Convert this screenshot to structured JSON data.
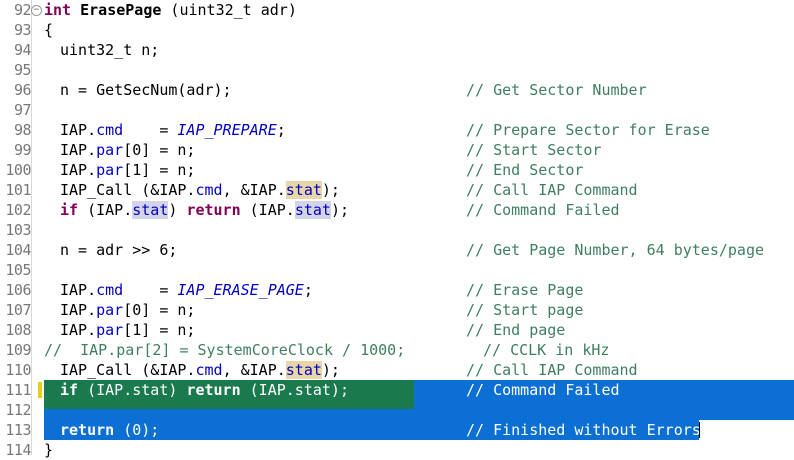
{
  "editor": {
    "function_name": "ErasePage",
    "lines": [
      {
        "n": "92",
        "fold": true,
        "code_kw": "int",
        "code_name": "ErasePage",
        "code_rest": " (uint32_t adr)",
        "comment": ""
      },
      {
        "n": "93",
        "code": "{",
        "comment": ""
      },
      {
        "n": "94",
        "code": "uint32_t n;",
        "comment": ""
      },
      {
        "n": "95",
        "code": "",
        "comment": ""
      },
      {
        "n": "96",
        "code": "n = GetSecNum(adr);",
        "comment": "// Get Sector Number"
      },
      {
        "n": "97",
        "code": "",
        "comment": ""
      },
      {
        "n": "98",
        "code_prefix": "IAP.",
        "code_field": "cmd",
        "code_mid": "    = ",
        "code_macro": "IAP_PREPARE",
        "code_tail": ";",
        "comment": "// Prepare Sector for Erase"
      },
      {
        "n": "99",
        "code_prefix": "IAP.",
        "code_field": "par",
        "code_tail": "[0] = n;",
        "comment": "// Start Sector"
      },
      {
        "n": "100",
        "code_prefix": "IAP.",
        "code_field": "par",
        "code_tail": "[1] = n;",
        "comment": "// End Sector"
      },
      {
        "n": "101",
        "code_a": "IAP_Call (&IAP.",
        "code_f1": "cmd",
        "code_b": ", &IAP.",
        "code_f2": "stat",
        "code_c": ");",
        "comment": "// Call IAP Command"
      },
      {
        "n": "102",
        "code_kw1": "if",
        "code_a": " (IAP.",
        "code_f1": "stat",
        "code_b": ") ",
        "code_kw2": "return",
        "code_c": " (IAP.",
        "code_f2": "stat",
        "code_d": ");",
        "comment": "// Command Failed"
      },
      {
        "n": "103",
        "code": "",
        "comment": ""
      },
      {
        "n": "104",
        "code": "n = adr >> 6;",
        "comment": "// Get Page Number, 64 bytes/page"
      },
      {
        "n": "105",
        "code": "",
        "comment": ""
      },
      {
        "n": "106",
        "code_prefix": "IAP.",
        "code_field": "cmd",
        "code_mid": "    = ",
        "code_macro": "IAP_ERASE_PAGE",
        "code_tail": ";",
        "comment": "// Erase Page"
      },
      {
        "n": "107",
        "code_prefix": "IAP.",
        "code_field": "par",
        "code_tail": "[0] = n;",
        "comment": "// Start page"
      },
      {
        "n": "108",
        "code_prefix": "IAP.",
        "code_field": "par",
        "code_tail": "[1] = n;",
        "comment": "// End page"
      },
      {
        "n": "109",
        "code": "//  IAP.par[2] = SystemCoreClock / 1000;",
        "comment": "// CCLK in kHz"
      },
      {
        "n": "110",
        "code_a": "IAP_Call (&IAP.",
        "code_f1": "cmd",
        "code_b": ", &IAP.",
        "code_f2": "stat",
        "code_c": ");",
        "comment": "// Call IAP Command"
      },
      {
        "n": "111",
        "code_kw1": "if",
        "code_a": " (IAP.stat) ",
        "code_kw2": "return",
        "code_c": " (IAP.stat);",
        "comment": "// Command Failed"
      },
      {
        "n": "112",
        "code": "",
        "comment": ""
      },
      {
        "n": "113",
        "code_kw1": "return",
        "code_a": " (0);",
        "comment": "// Finished without Errors"
      },
      {
        "n": "114",
        "code": "}",
        "comment": ""
      }
    ]
  },
  "colors": {
    "keyword": "#7f0055",
    "field": "#0000c0",
    "comment": "#3f7f5f",
    "selection": "#0b6fd4",
    "current_line_band": "#1a7a4e",
    "occurrence_highlight": "#e9d6a8"
  }
}
